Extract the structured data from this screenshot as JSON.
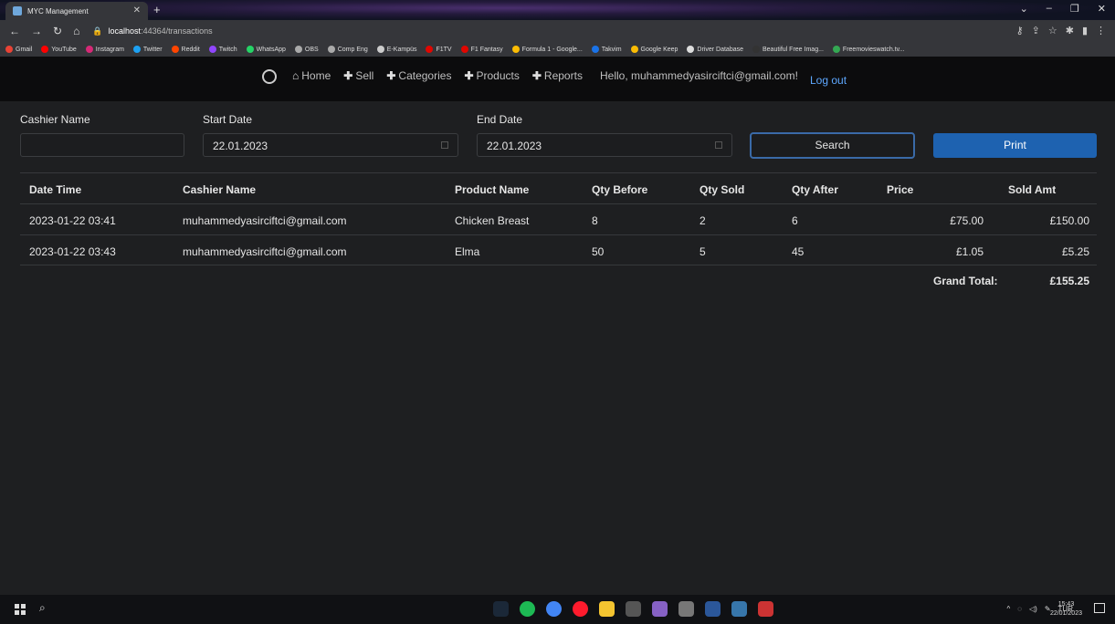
{
  "browser": {
    "tab_title": "MYC Management",
    "url_host": "localhost",
    "url_rest": ":44364/transactions",
    "bookmarks": [
      "Gmail",
      "YouTube",
      "Instagram",
      "Twitter",
      "Reddit",
      "Twitch",
      "WhatsApp",
      "OBS",
      "Comp Eng",
      "E-Kampüs",
      "F1TV",
      "F1 Fantasy",
      "Formula 1 - Google...",
      "Takvim",
      "Google Keep",
      "Driver Database",
      "Beautiful Free Imag...",
      "Freemovieswatch.tv..."
    ]
  },
  "nav": {
    "home": "Home",
    "sell": "Sell",
    "categories": "Categories",
    "products": "Products",
    "reports": "Reports",
    "hello": "Hello, muhammedyasirciftci@gmail.com!",
    "logout": "Log out"
  },
  "filters": {
    "cashier_label": "Cashier Name",
    "cashier_value": "",
    "start_label": "Start Date",
    "start_value": "22.01.2023",
    "end_label": "End Date",
    "end_value": "22.01.2023",
    "search_label": "Search",
    "print_label": "Print"
  },
  "table": {
    "headers": {
      "datetime": "Date Time",
      "cashier": "Cashier Name",
      "product": "Product Name",
      "qty_before": "Qty Before",
      "qty_sold": "Qty Sold",
      "qty_after": "Qty After",
      "price": "Price",
      "sold_amt": "Sold Amt"
    },
    "rows": [
      {
        "datetime": "2023-01-22 03:41",
        "cashier": "muhammedyasirciftci@gmail.com",
        "product": "Chicken Breast",
        "qty_before": "8",
        "qty_sold": "2",
        "qty_after": "6",
        "price": "£75.00",
        "sold_amt": "£150.00"
      },
      {
        "datetime": "2023-01-22 03:43",
        "cashier": "muhammedyasirciftci@gmail.com",
        "product": "Elma",
        "qty_before": "50",
        "qty_sold": "5",
        "qty_after": "45",
        "price": "£1.05",
        "sold_amt": "£5.25"
      }
    ],
    "grand_total_label": "Grand Total:",
    "grand_total_value": "£155.25"
  },
  "taskbar": {
    "lang": "TUR",
    "time": "15:43",
    "date": "22/01/2023"
  },
  "colors": {
    "accent": "#1e62b0",
    "link": "#5ea8ff",
    "background": "#1e1f21"
  }
}
